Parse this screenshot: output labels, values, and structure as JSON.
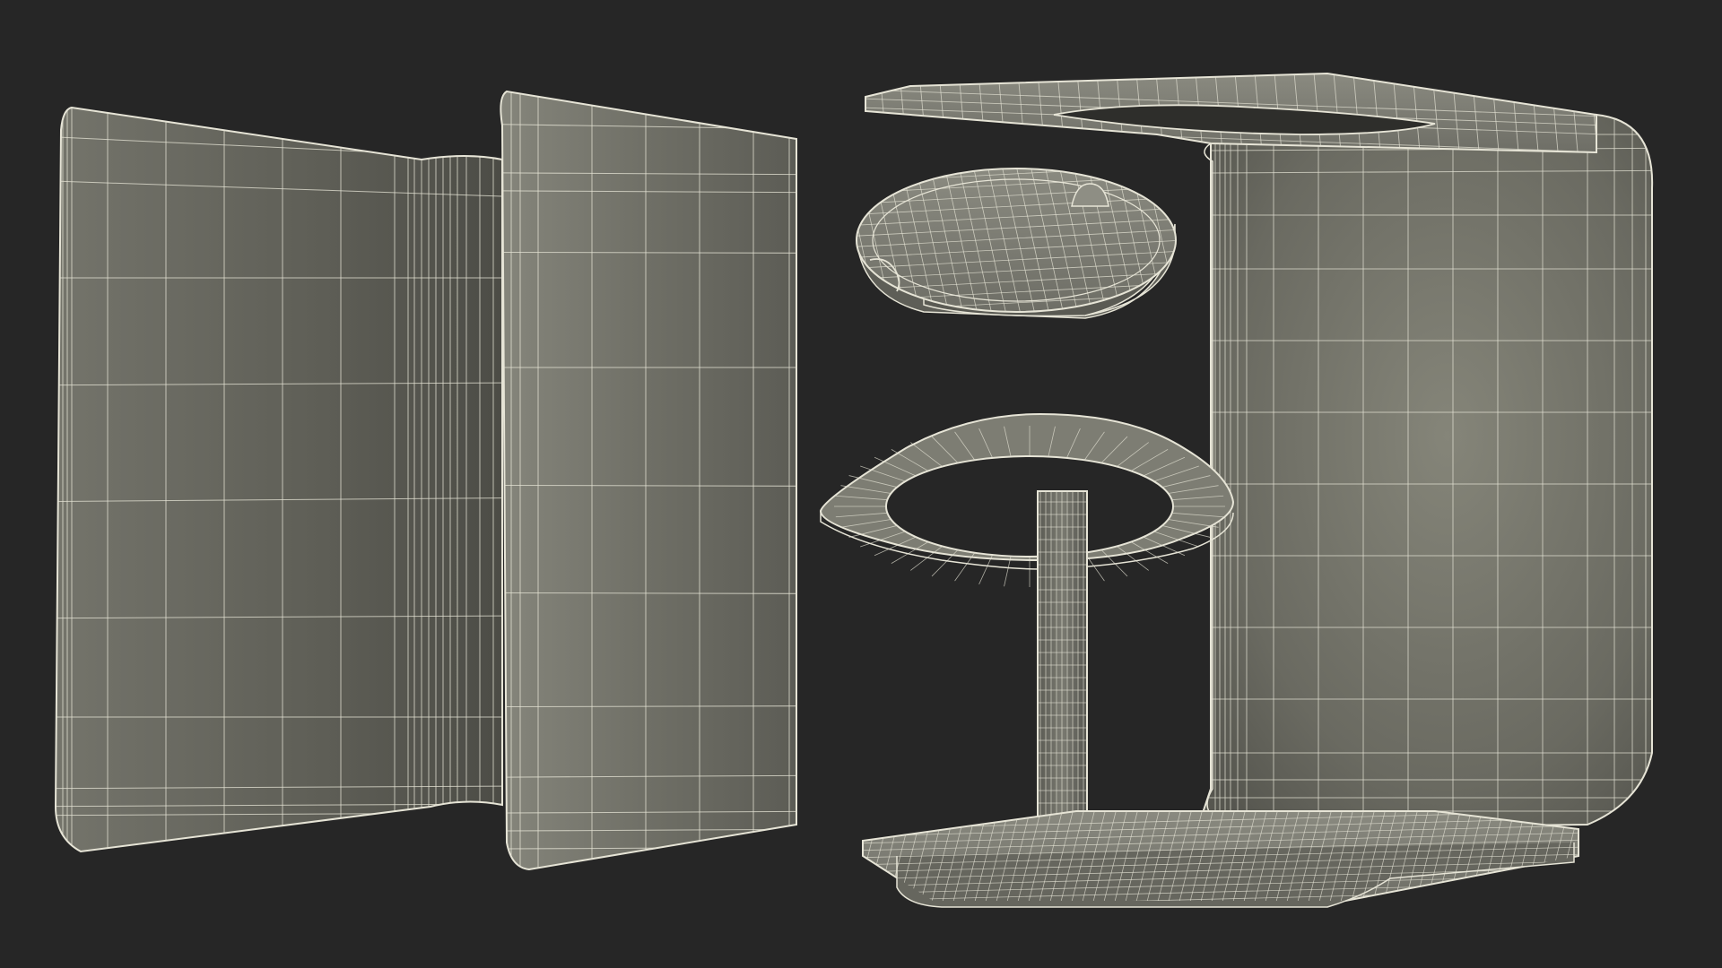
{
  "scene": {
    "background": "#262626",
    "wire_color": "#e6e4d6",
    "surface_light": "#84847a",
    "surface_mid": "#6b6b62",
    "surface_dark": "#4a4a44"
  },
  "parts": [
    {
      "name": "folded-panel",
      "icon": "wireframe-panel"
    },
    {
      "name": "top-plate",
      "icon": "wireframe-plate"
    },
    {
      "name": "round-lid",
      "icon": "wireframe-disc"
    },
    {
      "name": "ring-bracket",
      "icon": "wireframe-ring"
    },
    {
      "name": "pole",
      "icon": "wireframe-cylinder"
    },
    {
      "name": "c-frame",
      "icon": "wireframe-frame"
    },
    {
      "name": "base-plate",
      "icon": "wireframe-base"
    }
  ]
}
